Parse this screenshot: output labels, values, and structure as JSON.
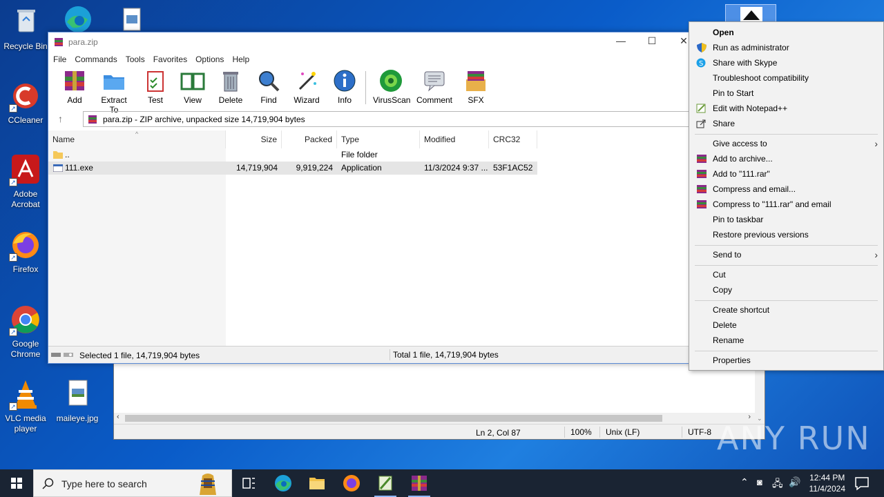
{
  "desktop": {
    "icons": [
      {
        "label": "Recycle Bin"
      },
      {
        "label": "CCleaner"
      },
      {
        "label": "Adobe Acrobat"
      },
      {
        "label": "Firefox"
      },
      {
        "label": "Google Chrome"
      },
      {
        "label": "VLC media player"
      },
      {
        "label": "maileye.jpg"
      }
    ]
  },
  "winrar": {
    "title": "para.zip",
    "menu": [
      "File",
      "Commands",
      "Tools",
      "Favorites",
      "Options",
      "Help"
    ],
    "toolbar": [
      "Add",
      "Extract To",
      "Test",
      "View",
      "Delete",
      "Find",
      "Wizard",
      "Info",
      "VirusScan",
      "Comment",
      "SFX"
    ],
    "address": "para.zip - ZIP archive, unpacked size 14,719,904 bytes",
    "columns": [
      "Name",
      "Size",
      "Packed",
      "Type",
      "Modified",
      "CRC32"
    ],
    "rows": [
      {
        "name": "..",
        "size": "",
        "packed": "",
        "type": "File folder",
        "modified": "",
        "crc": ""
      },
      {
        "name": "111.exe",
        "size": "14,719,904",
        "packed": "9,919,224",
        "type": "Application",
        "modified": "11/3/2024 9:37 ...",
        "crc": "53F1AC52"
      }
    ],
    "status_left": "Selected 1 file, 14,719,904 bytes",
    "status_right": "Total 1 file, 14,719,904 bytes"
  },
  "notepad_status": {
    "position": "Ln 2, Col 87",
    "zoom": "100%",
    "eol": "Unix (LF)",
    "encoding": "UTF-8"
  },
  "context_menu": {
    "items": [
      {
        "label": "Open"
      },
      {
        "label": "Run as administrator"
      },
      {
        "label": "Share with Skype"
      },
      {
        "label": "Troubleshoot compatibility"
      },
      {
        "label": "Pin to Start"
      },
      {
        "label": "Edit with Notepad++"
      },
      {
        "label": "Share"
      },
      {
        "label": "Give access to"
      },
      {
        "label": "Add to archive..."
      },
      {
        "label": "Add to \"111.rar\""
      },
      {
        "label": "Compress and email..."
      },
      {
        "label": "Compress to \"111.rar\" and email"
      },
      {
        "label": "Pin to taskbar"
      },
      {
        "label": "Restore previous versions"
      },
      {
        "label": "Send to"
      },
      {
        "label": "Cut"
      },
      {
        "label": "Copy"
      },
      {
        "label": "Create shortcut"
      },
      {
        "label": "Delete"
      },
      {
        "label": "Rename"
      },
      {
        "label": "Properties"
      }
    ]
  },
  "taskbar": {
    "search_placeholder": "Type here to search",
    "time": "12:44 PM",
    "date": "11/4/2024"
  },
  "watermark": "ANY RUN"
}
